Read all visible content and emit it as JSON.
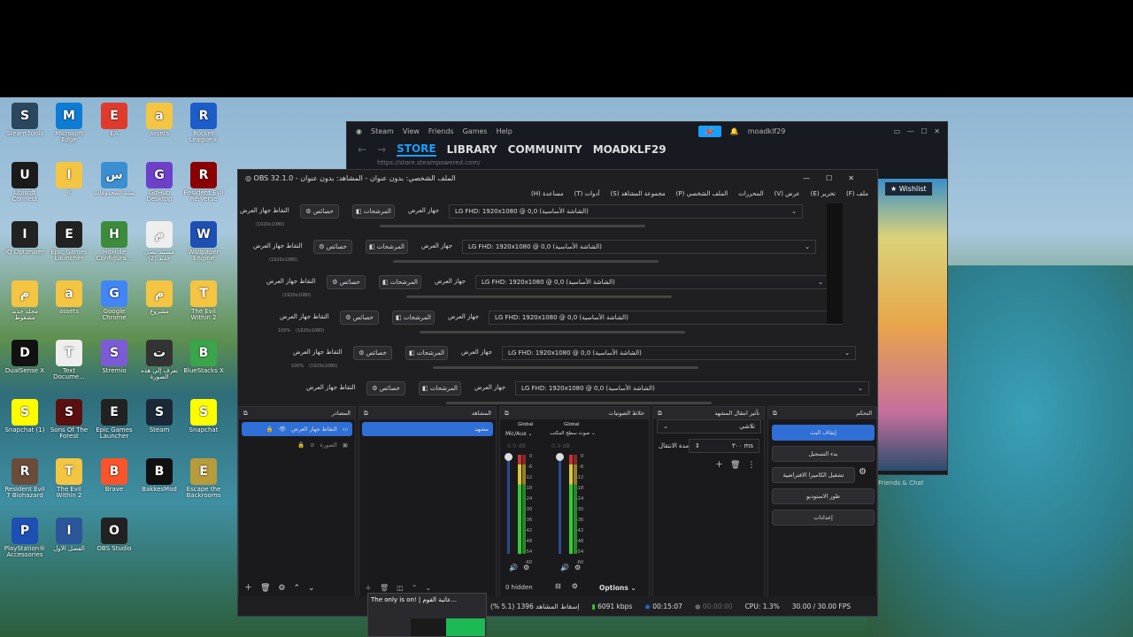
{
  "desktop": {
    "icons": [
      {
        "label": "Steam.tools",
        "icon": "steam-icon",
        "color": "#2a475e"
      },
      {
        "label": "Microsoft Edge",
        "icon": "edge-icon",
        "color": "#0c7cd5"
      },
      {
        "label": "EA",
        "icon": "ea-icon",
        "color": "#e03a2c"
      },
      {
        "label": "assets",
        "icon": "folder-icon",
        "color": "#f4c542"
      },
      {
        "label": "Rocket League®",
        "icon": "rocket-league-icon",
        "color": "#1d5dc9"
      },
      {
        "label": "Ubisoft Connect",
        "icon": "ubisoft-icon",
        "color": "#1b1b1b"
      },
      {
        "label": "اا",
        "icon": "folder-icon",
        "color": "#f4c542"
      },
      {
        "label": "سلة المحذوفات",
        "icon": "recycle-bin-icon",
        "color": "#3b8fd1"
      },
      {
        "label": "GitHub Desktop",
        "icon": "github-icon",
        "color": "#6e40c9"
      },
      {
        "label": "Resident Evil Re:Verse",
        "icon": "re-verse-icon",
        "color": "#8b0000"
      },
      {
        "label": "IQ Optimizer",
        "icon": "iq-icon",
        "color": "#222"
      },
      {
        "label": "Epic Games Launcher",
        "icon": "epic-icon",
        "color": "#222"
      },
      {
        "label": "HitHide Configura...",
        "icon": "hithide-icon",
        "color": "#3c8c3c"
      },
      {
        "label": "مستند نصي جديد (2)",
        "icon": "document-icon",
        "color": "#eee"
      },
      {
        "label": "Wallpaper Engine",
        "icon": "wallpaper-icon",
        "color": "#1e4fb3"
      },
      {
        "label": "مجلد جديد مضغوط",
        "icon": "zip-folder-icon",
        "color": "#f4c542"
      },
      {
        "label": "assets",
        "icon": "folder-icon",
        "color": "#f4c542"
      },
      {
        "label": "Google Chrome",
        "icon": "chrome-icon",
        "color": "#4285f4"
      },
      {
        "label": "مشروع",
        "icon": "folder-icon",
        "color": "#f4c542"
      },
      {
        "label": "The Evil Within 2",
        "icon": "folder-icon",
        "color": "#f4c542"
      },
      {
        "label": "DualSense X",
        "icon": "dualsense-icon",
        "color": "#111"
      },
      {
        "label": "Text Docume...",
        "icon": "document-icon",
        "color": "#eee"
      },
      {
        "label": "Stremio",
        "icon": "stremio-icon",
        "color": "#7b5bd6"
      },
      {
        "label": "تعرف إلى هذه الصورة",
        "icon": "info-icon",
        "color": "#333"
      },
      {
        "label": "BlueStacks X",
        "icon": "bluestacks-icon",
        "color": "#3aa54a"
      },
      {
        "label": "Snapchat (1)",
        "icon": "snapchat-icon",
        "color": "#fffc00"
      },
      {
        "label": "Sons Of The Forest",
        "icon": "sons-forest-icon",
        "color": "#5a1010"
      },
      {
        "label": "Epic Games Launcher",
        "icon": "epic-icon",
        "color": "#222"
      },
      {
        "label": "Steam",
        "icon": "steam-icon",
        "color": "#1b2838"
      },
      {
        "label": "Snapchat",
        "icon": "snapchat-icon",
        "color": "#fffc00"
      },
      {
        "label": "Resident Evil 7 Biohazard",
        "icon": "re7-icon",
        "color": "#6b4c3a"
      },
      {
        "label": "The Evil Within 2",
        "icon": "folder-icon",
        "color": "#f4c542"
      },
      {
        "label": "Brave",
        "icon": "brave-icon",
        "color": "#fb542b"
      },
      {
        "label": "BakkesMod",
        "icon": "bakkesmod-icon",
        "color": "#111"
      },
      {
        "label": "Escape the Backrooms",
        "icon": "backrooms-icon",
        "color": "#b79c3b"
      },
      {
        "label": "PlayStation® Accessories",
        "icon": "playstation-icon",
        "color": "#1e4fb3"
      },
      {
        "label": "الفصل الاول",
        "icon": "word-doc-icon",
        "color": "#2b579a"
      },
      {
        "label": "OBS Studio",
        "icon": "obs-icon",
        "color": "#222"
      }
    ]
  },
  "steam": {
    "menu": [
      "Steam",
      "View",
      "Friends",
      "Games",
      "Help"
    ],
    "user": "moadklf29",
    "nav": [
      "STORE",
      "LIBRARY",
      "COMMUNITY",
      "MOADKLF29"
    ],
    "url": "https://store.steampowered.com/",
    "wishlist": "Wishlist",
    "friends_chat": "Friends & Chat"
  },
  "obs": {
    "title": "OBS 32.1.0 - الملف الشخصي: بدون عنوان - المشاهد: بدون عنوان",
    "menu": [
      "ملف (F)",
      "تحرير (E)",
      "عرض (V)",
      "الملف الشخصي (P)",
      "مجموعة المشاهد (S)",
      "أدوات (T)",
      "مساعدة (H)"
    ],
    "menu_extra": "المحررات",
    "source_rows": [
      {
        "label": "التقاط جهاز العرض",
        "props": "خصائص",
        "filters": "المرشحات",
        "display": "جهاز العرض",
        "value": "LG FHD: 1920x1080 @ 0,0 (الشاشة الأساسية)",
        "res": "(1920x1080)"
      },
      {
        "label": "التقاط جهاز العرض",
        "props": "خصائص",
        "filters": "المرشحات",
        "display": "جهاز العرض",
        "value": "LG FHD: 1920x1080 @ 0,0 (الشاشة الأساسية)",
        "res": "(1920x1080)"
      },
      {
        "label": "التقاط جهاز العرض",
        "props": "خصائص",
        "filters": "المرشحات",
        "display": "جهاز العرض",
        "value": "LG FHD: 1920x1080 @ 0,0 (الشاشة الأساسية)",
        "res": "(1920x1080)"
      },
      {
        "label": "التقاط جهاز العرض",
        "props": "خصائص",
        "filters": "المرشحات",
        "display": "جهاز العرض",
        "value": "LG FHD: 1920x1080 @ 0,0 (الشاشة الأساسية)",
        "res": "(1920x1080)",
        "zoom": "100%"
      },
      {
        "label": "التقاط جهاز العرض",
        "props": "خصائص",
        "filters": "المرشحات",
        "display": "جهاز العرض",
        "value": "LG FHD: 1920x1080 @ 0,0 (الشاشة الأساسية)",
        "res": "(1920x1080)",
        "zoom": "100%"
      },
      {
        "label": "التقاط جهاز العرض",
        "props": "خصائص",
        "filters": "المرشحات",
        "display": "جهاز العرض",
        "value": "LG FHD: 1920x1080 @ 0,0 (الشاشة الأساسية)",
        "res": ""
      }
    ],
    "docks": {
      "sources": {
        "title": "المصادر",
        "items": [
          {
            "name": "التقاط جهاز العرض",
            "selected": true
          },
          {
            "name": "الصورة",
            "selected": false
          }
        ]
      },
      "scenes": {
        "title": "المشاهد",
        "items": [
          {
            "name": "مشهد",
            "selected": true
          }
        ]
      },
      "mixer": {
        "title": "خلاط الصوتيات",
        "channels": [
          {
            "tag": "Global",
            "name": "Mic/Aux",
            "db": "0.0 dB"
          },
          {
            "tag": "Global",
            "name": "صوت سطح المكتب",
            "db": "0.0 dB"
          }
        ],
        "scale": [
          "0",
          "-6",
          "-12",
          "-18",
          "-24",
          "-30",
          "-36",
          "-42",
          "-48",
          "-54",
          "-60"
        ],
        "hidden": "0 hidden",
        "options": "Options"
      },
      "transitions": {
        "title": "تأثير انتقال المشهد",
        "type": "تلاشي",
        "duration_label": "مدة الانتقال",
        "duration": "٣٠٠ ms"
      },
      "controls": {
        "title": "التحكم",
        "buttons": [
          "إيقاف البث",
          "بدء التسجيل",
          "تشغيل الكاميرا الافتراضية",
          "طور الاستوديو",
          "إعدادات"
        ]
      }
    },
    "status": {
      "dropped": "إسقاط المشاهد 1396 (5.1 %)",
      "bitrate": "6091 kbps",
      "stream_time": "00:15:07",
      "rec_time": "00:00:00",
      "cpu": "CPU: 1.3%",
      "fps": "30.00 / 30.00 FPS"
    }
  },
  "taskbar_popup": {
    "title": "The only is on! | عاتبة القوم..."
  }
}
